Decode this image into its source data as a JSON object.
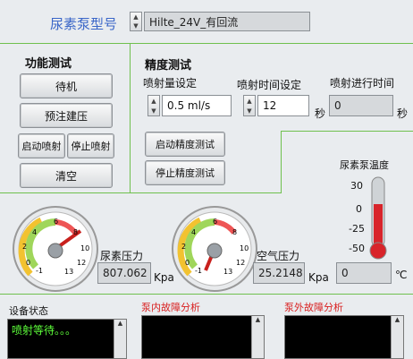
{
  "header": {
    "pump_model_label": "尿素泵型号",
    "pump_model_value": "Hilte_24V_有回流"
  },
  "func_test": {
    "title": "功能测试",
    "standby": "待机",
    "prefill": "预注建压",
    "start_inject": "启动喷射",
    "stop_inject": "停止喷射",
    "clear": "清空"
  },
  "precision": {
    "title": "精度测试",
    "inject_amount_label": "喷射量设定",
    "inject_amount_value": "0.5 ml/s",
    "inject_time_label": "喷射时间设定",
    "inject_time_value": "12",
    "inject_time_unit": "秒",
    "progress_label": "喷射进行时间",
    "progress_value": "0",
    "progress_unit": "秒",
    "start_btn": "启动精度测试",
    "stop_btn": "停止精度测试"
  },
  "temperature": {
    "label": "尿素泵温度",
    "ticks": [
      "30",
      "0",
      "-25",
      "-50"
    ],
    "value": "0",
    "unit": "℃",
    "level_fraction": 0.625
  },
  "urea_gauge": {
    "label": "尿素压力",
    "value": "807.062",
    "unit": "Kpa",
    "ticks": [
      "-1",
      "0",
      "2",
      "4",
      "6",
      "8",
      "10",
      "12",
      "13"
    ]
  },
  "air_gauge": {
    "label": "空气压力",
    "value": "25.2148",
    "unit": "Kpa",
    "ticks": [
      "-1",
      "0",
      "2",
      "4",
      "6",
      "8",
      "10",
      "12",
      "13"
    ]
  },
  "status": {
    "device_label": "设备状态",
    "device_text": "喷射等待。。。",
    "internal_fault_label": "泵内故障分析",
    "external_fault_label": "泵外故障分析"
  },
  "colors": {
    "border_green": "#6fc04e",
    "fault_label_red": "#d92020",
    "header_blue": "#3a66c8",
    "log_green": "#5dff3a"
  },
  "icons": [
    "spin-up-icon",
    "spin-down-icon",
    "scroll-up-icon"
  ]
}
